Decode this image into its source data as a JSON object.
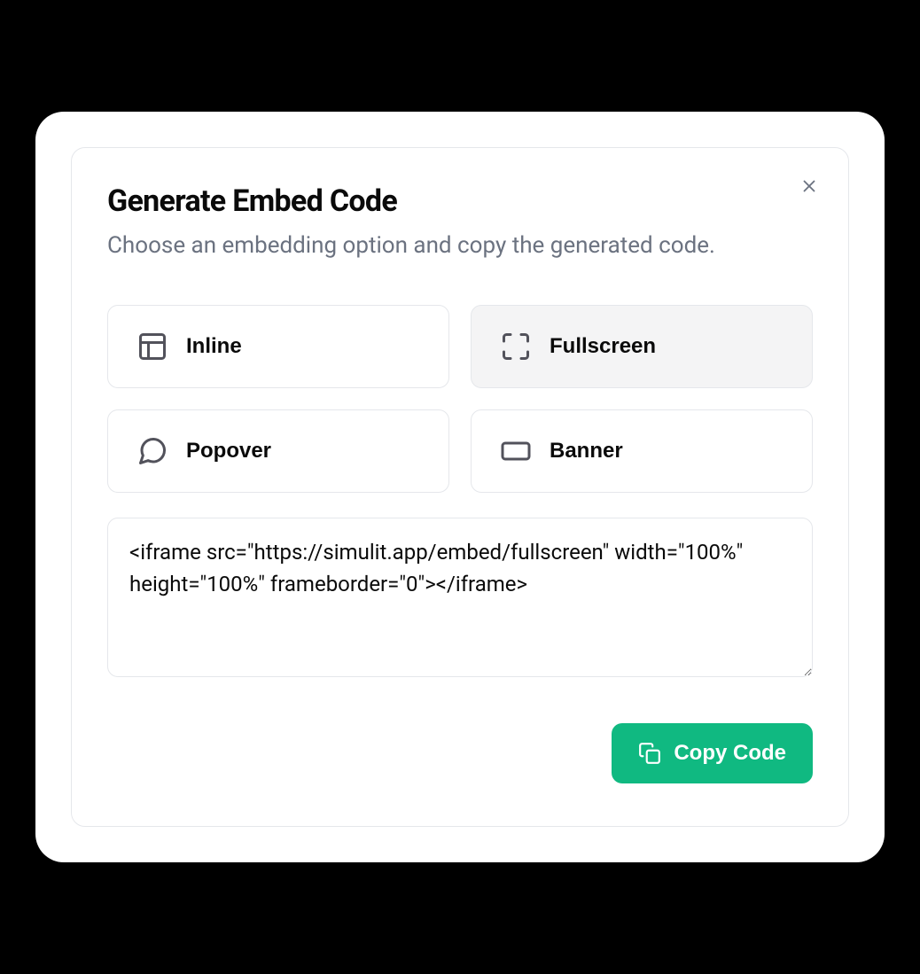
{
  "dialog": {
    "title": "Generate Embed Code",
    "subtitle": "Choose an embedding option and copy the generated code."
  },
  "options": {
    "inline": {
      "label": "Inline",
      "selected": false
    },
    "fullscreen": {
      "label": "Fullscreen",
      "selected": true
    },
    "popover": {
      "label": "Popover",
      "selected": false
    },
    "banner": {
      "label": "Banner",
      "selected": false
    }
  },
  "code": {
    "value": "<iframe src=\"https://simulit.app/embed/fullscreen\" width=\"100%\" height=\"100%\" frameborder=\"0\"></iframe>"
  },
  "actions": {
    "copy_label": "Copy Code"
  }
}
